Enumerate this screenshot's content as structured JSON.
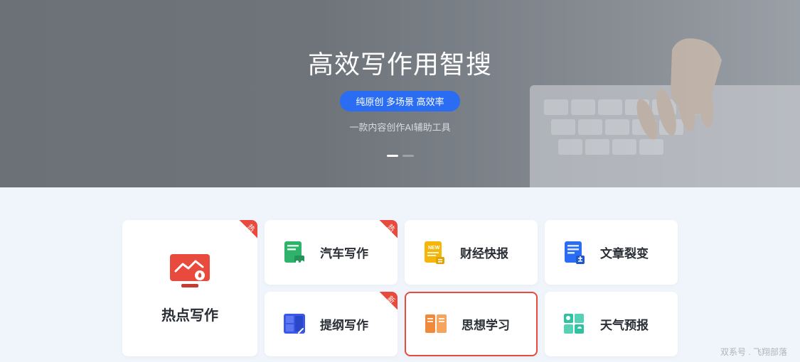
{
  "hero": {
    "title": "高效写作用智搜",
    "pill": "纯原创 多场景 高效率",
    "subtitle": "一款内容创作AI辅助工具"
  },
  "featured": {
    "label": "热点写作",
    "badge": "热",
    "icon_color": "#e84a3d"
  },
  "cards": [
    {
      "label": "汽车写作",
      "badge": "热",
      "icon_color": "#2fb36a",
      "selected": false
    },
    {
      "label": "财经快报",
      "badge": "",
      "icon_color": "#f5b60a",
      "selected": false
    },
    {
      "label": "文章裂变",
      "badge": "",
      "icon_color": "#2a6df3",
      "selected": false
    },
    {
      "label": "提纲写作",
      "badge": "新",
      "icon_color": "#3a57e8",
      "selected": false
    },
    {
      "label": "思想学习",
      "badge": "",
      "icon_color": "#f08a3a",
      "selected": true
    },
    {
      "label": "天气预报",
      "badge": "",
      "icon_color": "#2ec2a0",
      "selected": false
    }
  ],
  "watermark": "双系号 . 飞翔部落",
  "colors": {
    "accent": "#2a6df3",
    "danger": "#e84a3d",
    "card_bg": "#ffffff",
    "page_bg": "#f0f5fb"
  }
}
